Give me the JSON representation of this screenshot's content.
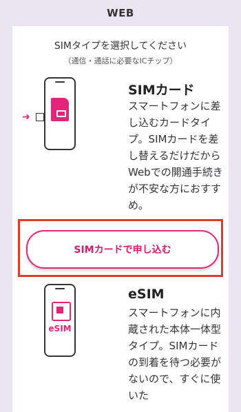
{
  "header": {
    "title": "WEB"
  },
  "section": {
    "title": "SIMタイプを選択してください",
    "subtitle": "（通信・通話に必要なICチップ）"
  },
  "options": [
    {
      "title": "SIMカード",
      "description": "スマートフォンに差し込むカードタイプ。SIMカードを差し替えるだけだからWebでの開通手続きが不安な方におすすめ。",
      "button_label": "SIMカードで申し込む",
      "icon": "sim-card-icon"
    },
    {
      "title": "eSIM",
      "description": "スマートフォンに内蔵された本体一体型タイプ。SIMカードの到着を待つ必要がないので、すぐに使いた",
      "icon_label": "eSIM",
      "icon": "esim-chip-icon"
    }
  ],
  "colors": {
    "accent": "#e0267a",
    "highlight": "#e23a2a",
    "background": "#ebe4f1"
  }
}
